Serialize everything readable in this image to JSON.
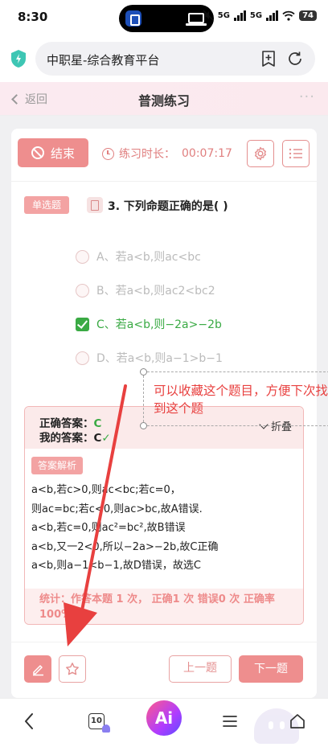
{
  "status_bar": {
    "time": "8:30",
    "net1": "5G",
    "net2": "5G",
    "battery": "74"
  },
  "browser": {
    "title": "中职星-综合教育平台"
  },
  "header": {
    "back_label": "返回",
    "title": "普测练习",
    "more": "···"
  },
  "toolbar": {
    "end_label": "结束",
    "timer_label": "练习时长：",
    "timer_value": "00:07:17"
  },
  "question": {
    "type_badge": "单选题",
    "text": "3. 下列命题正确的是( )",
    "options": [
      {
        "label": "A、若a<b,则ac<bc"
      },
      {
        "label": "B、若a<b,则ac2<bc2"
      },
      {
        "label": "C、若a<b,则−2a>−2b"
      },
      {
        "label": "D、若a<b,则a−1>b−1"
      }
    ],
    "selected_option": "C"
  },
  "analysis": {
    "correct_label": "正确答案：",
    "correct_value": "C",
    "mine_label": "我的答案：",
    "mine_value": "C",
    "fold_label": "折叠",
    "badge": "答案解析",
    "lines": [
      "a<b,若c>0,则ac<bc;若c=0，",
      "则ac=bc;若c<0,则ac>bc,故A错误.",
      "a<b,若c=0,则ac²=bc²,故B错误",
      "a<b,又一2<0,所以−2a>−2b,故C正确",
      "a<b,则a−1<b−1,故D错误，故选C"
    ],
    "stats": "统计：作答本题 1 次，  正确1 次 错误0 次 正确率100%"
  },
  "actions": {
    "prev_label": "上一题",
    "next_label": "下一题"
  },
  "annotation": {
    "text": "可以收藏这个题目，方便下次找到这个题"
  },
  "bottom_nav": {
    "tab_count": "10",
    "ai_label": "Ai"
  },
  "colors": {
    "accent": "#ee8e8e",
    "correct": "#3aaa44",
    "annotation": "#e8403f"
  }
}
